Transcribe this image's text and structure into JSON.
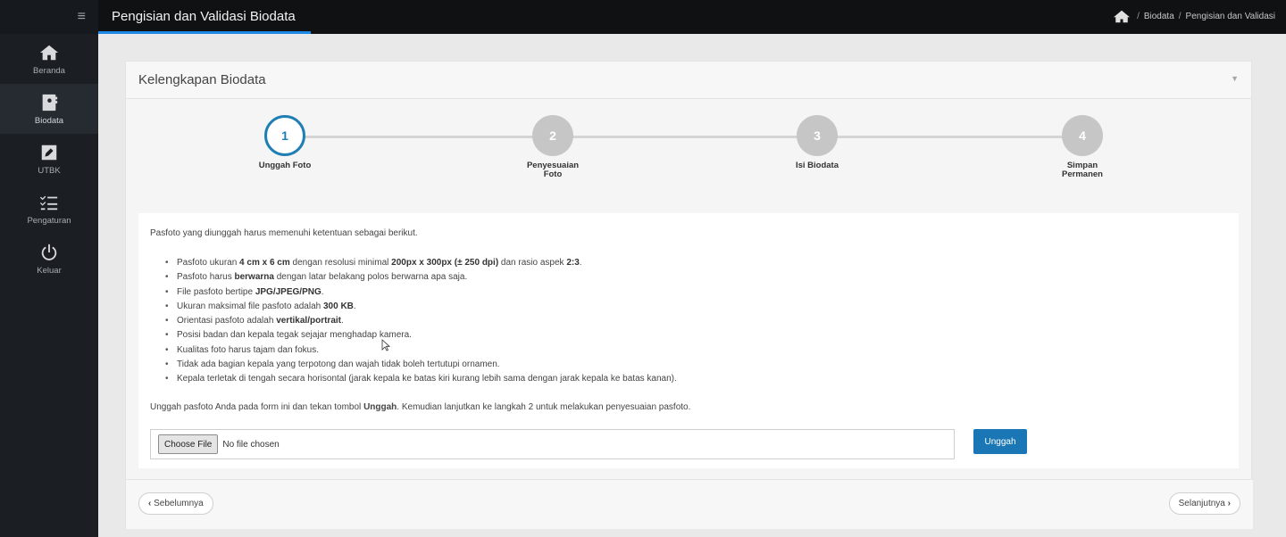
{
  "topbar": {
    "title": "Pengisian dan Validasi Biodata",
    "breadcrumb": [
      "Biodata",
      "Pengisian dan Validasi"
    ],
    "breadcrumb_sep": "/"
  },
  "sidebar": {
    "menu_icon": "≡",
    "items": [
      {
        "label": "Beranda",
        "icon": "home-icon"
      },
      {
        "label": "Biodata",
        "icon": "contact-book-icon",
        "active": true
      },
      {
        "label": "UTBK",
        "icon": "edit-icon"
      },
      {
        "label": "Pengaturan",
        "icon": "checklist-icon"
      },
      {
        "label": "Keluar",
        "icon": "power-icon"
      }
    ]
  },
  "card": {
    "title": "Kelengkapan Biodata",
    "toggle": "▼"
  },
  "steps": [
    {
      "number": "1",
      "label": "Unggah Foto",
      "active": true
    },
    {
      "number": "2",
      "label": "Penyesuaian Foto"
    },
    {
      "number": "3",
      "label": "Isi Biodata"
    },
    {
      "number": "4",
      "label": "Simpan Permanen"
    }
  ],
  "content": {
    "intro": "Pasfoto yang diunggah harus memenuhi ketentuan sebagai berikut.",
    "rules": {
      "r0": {
        "a": "Pasfoto ukuran ",
        "b1": "4 cm x 6 cm",
        "c": " dengan resolusi minimal ",
        "b2": "200px x 300px (± 250 dpi)",
        "d": " dan rasio aspek ",
        "b3": "2:3",
        "e": "."
      },
      "r1": {
        "a": "Pasfoto harus ",
        "b1": "berwarna",
        "c": " dengan latar belakang polos berwarna apa saja."
      },
      "r2": {
        "a": "File pasfoto bertipe ",
        "b1": "JPG/JPEG/PNG",
        "c": "."
      },
      "r3": {
        "a": "Ukuran maksimal file pasfoto adalah ",
        "b1": "300 KB",
        "c": "."
      },
      "r4": {
        "a": "Orientasi pasfoto adalah ",
        "b1": "vertikal/portrait",
        "c": "."
      },
      "r5": "Posisi badan dan kepala tegak sejajar menghadap kamera.",
      "r6": "Kualitas foto harus tajam dan fokus.",
      "r7": "Tidak ada bagian kepala yang terpotong dan wajah tidak boleh tertutupi ornamen.",
      "r8": "Kepala terletak di tengah secara horisontal (jarak kepala ke batas kiri kurang lebih sama dengan jarak kepala ke batas kanan)."
    },
    "instruction": {
      "a": "Unggah pasfoto Anda pada form ini dan tekan tombol ",
      "b": "Unggah",
      "c": ". Kemudian lanjutkan ke langkah 2 untuk melakukan penyesuaian pasfoto."
    },
    "file_button": "Choose File",
    "file_status": "No file chosen",
    "upload_button": "Unggah"
  },
  "footer": {
    "prev": "Sebelumnya",
    "next": "Selanjutnya",
    "prev_chev": "‹",
    "next_chev": "›"
  }
}
